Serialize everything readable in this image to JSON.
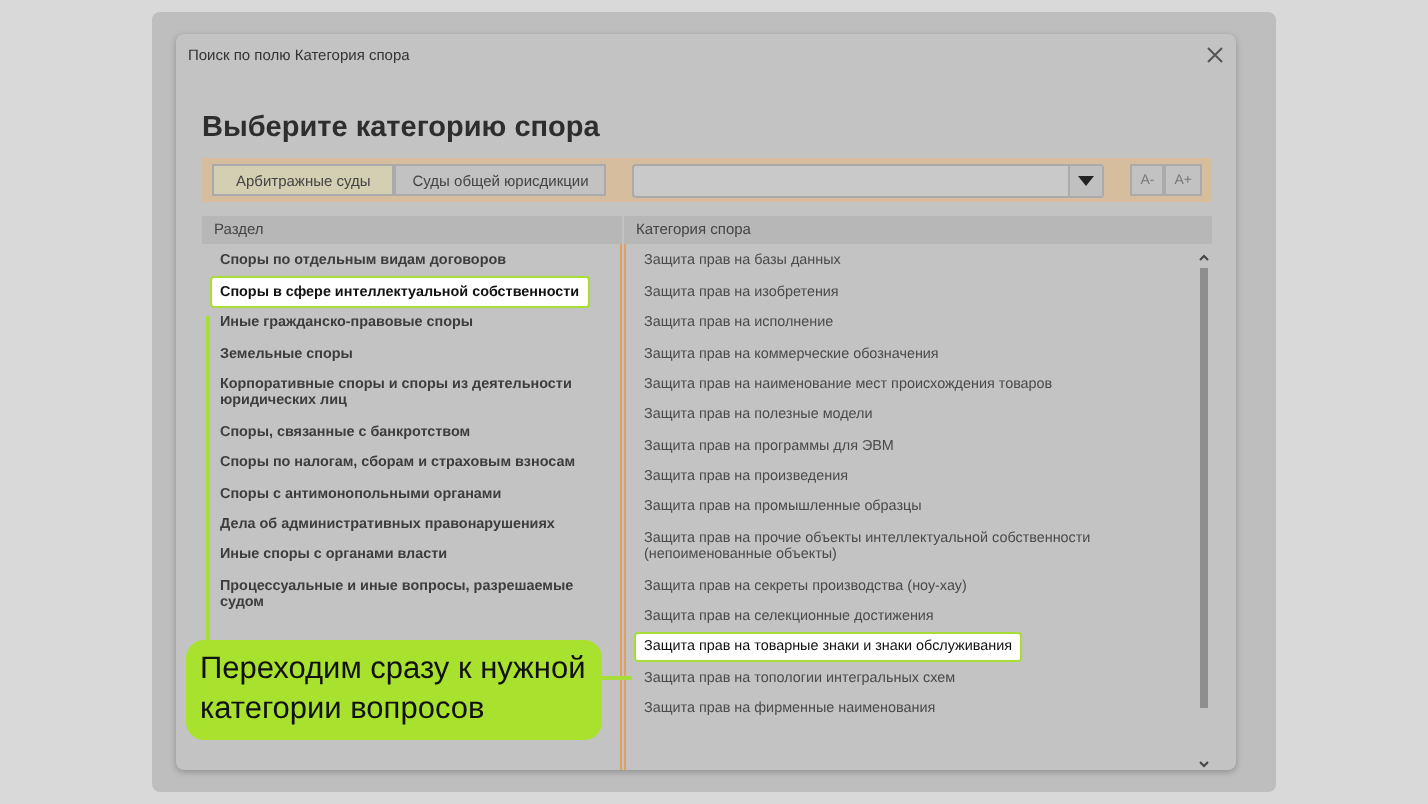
{
  "window": {
    "title": "Поиск по полю Категория спора"
  },
  "heading": "Выберите категорию спора",
  "tabs": [
    {
      "label": "Арбитражные суды",
      "selected": true
    },
    {
      "label": "Суды общей юрисдикции",
      "selected": false
    }
  ],
  "font_buttons": [
    "A-",
    "A+"
  ],
  "columns": [
    "Раздел",
    "Категория спора"
  ],
  "sections": [
    {
      "label": "Споры по отдельным видам договоров",
      "selected": false
    },
    {
      "label": "Споры в сфере интеллектуальной собственности",
      "selected": true
    },
    {
      "label": "Иные гражданско-правовые споры",
      "selected": false
    },
    {
      "label": "Земельные споры",
      "selected": false
    },
    {
      "label": "Корпоративные споры и споры из деятельности юридических лиц",
      "selected": false
    },
    {
      "label": "Споры, связанные с банкротством",
      "selected": false
    },
    {
      "label": "Споры по налогам, сборам и страховым взносам",
      "selected": false
    },
    {
      "label": "Споры с антимонопольными органами",
      "selected": false
    },
    {
      "label": "Дела об административных правонарушениях",
      "selected": false
    },
    {
      "label": "Иные споры с органами власти",
      "selected": false
    },
    {
      "label": "Процессуальные и иные вопросы, разрешаемые судом",
      "selected": false
    }
  ],
  "categories": [
    {
      "label": "Защита прав на базы данных",
      "selected": false
    },
    {
      "label": "Защита прав на изобретения",
      "selected": false
    },
    {
      "label": "Защита прав на исполнение",
      "selected": false
    },
    {
      "label": "Защита прав на коммерческие обозначения",
      "selected": false
    },
    {
      "label": "Защита прав на наименование мест происхождения товаров",
      "selected": false
    },
    {
      "label": "Защита прав на полезные модели",
      "selected": false
    },
    {
      "label": "Защита прав на программы для ЭВМ",
      "selected": false
    },
    {
      "label": "Защита прав на произведения",
      "selected": false
    },
    {
      "label": "Защита прав на промышленные образцы",
      "selected": false
    },
    {
      "label": "Защита прав на прочие объекты интеллектуальной собственности (непоименованные объекты)",
      "selected": false
    },
    {
      "label": "Защита прав на секреты производства (ноу-хау)",
      "selected": false
    },
    {
      "label": "Защита прав на селекционные достижения",
      "selected": false
    },
    {
      "label": "Защита прав на товарные знаки и знаки обслуживания",
      "selected": true
    },
    {
      "label": "Защита прав на топологии интегральных схем",
      "selected": false
    },
    {
      "label": "Защита прав на фирменные наименования",
      "selected": false
    }
  ],
  "callout": "Переходим сразу к нужной категории вопросов"
}
